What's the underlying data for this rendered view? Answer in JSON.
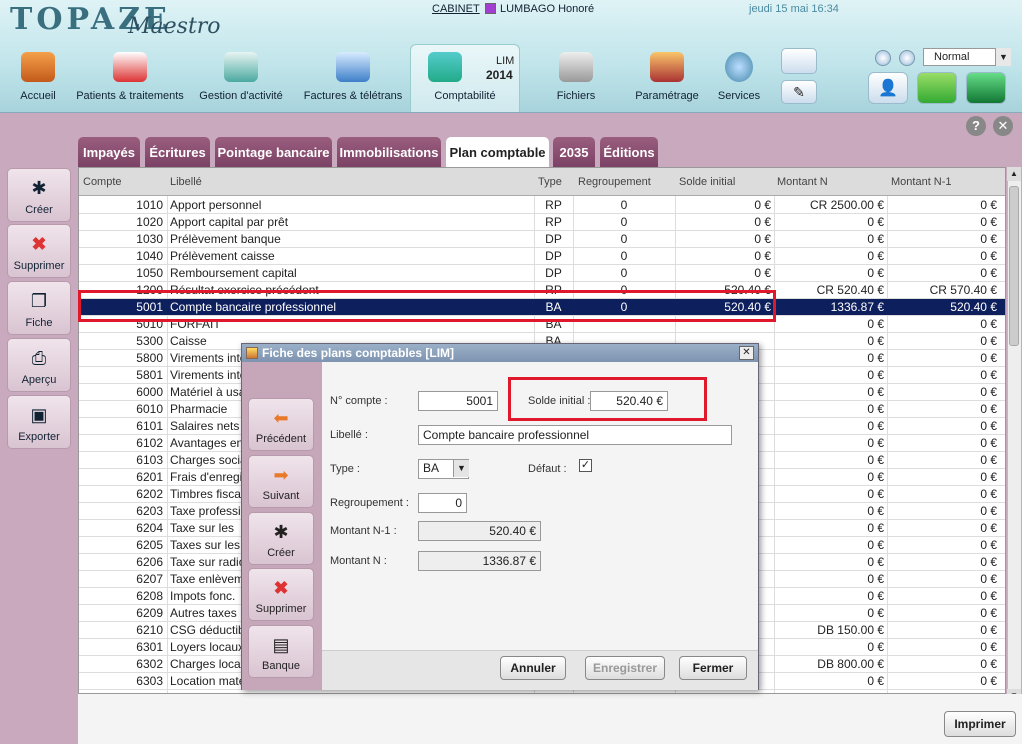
{
  "app": {
    "logo": "TOPAZE",
    "logo_sub": "Maestro"
  },
  "topbar": {
    "cabinet": "CABINET",
    "user": "LUMBAGO Honoré",
    "user_color": "#a23fd0",
    "datetime": "jeudi 15 mai 16:34"
  },
  "modules": [
    {
      "label": "Accueil",
      "icon": "house-icon"
    },
    {
      "label": "Patients & traitements",
      "icon": "patients-icon"
    },
    {
      "label": "Gestion d'activité",
      "icon": "folder-icon"
    },
    {
      "label": "Factures & télétrans",
      "icon": "computer-icon"
    },
    {
      "label": "Comptabilité",
      "icon": "calculator-icon",
      "badge_top": "LIM",
      "badge_year": "2014"
    },
    {
      "label": "Fichiers",
      "icon": "database-icon"
    },
    {
      "label": "Paramétrage",
      "icon": "gears-icon"
    },
    {
      "label": "Services",
      "icon": "globe-icon"
    }
  ],
  "view_mode": "Normal",
  "tabs": [
    "Impayés",
    "Écritures",
    "Pointage bancaire",
    "Immobilisations",
    "Plan comptable",
    "2035",
    "Éditions"
  ],
  "active_tab": "Plan comptable",
  "side_actions": [
    "Créer",
    "Supprimer",
    "Fiche",
    "Aperçu",
    "Exporter"
  ],
  "table": {
    "columns": [
      "Compte",
      "Libellé",
      "Type",
      "Regroupement",
      "Solde initial",
      "Montant N",
      "Montant N-1"
    ],
    "rows": [
      [
        "1010",
        "Apport personnel",
        "RP",
        "0",
        "0 €",
        "CR 2500.00 €",
        "0 €"
      ],
      [
        "1020",
        "Apport capital par prêt",
        "RP",
        "0",
        "0 €",
        "0 €",
        "0 €"
      ],
      [
        "1030",
        "Prélèvement banque",
        "DP",
        "0",
        "0 €",
        "0 €",
        "0 €"
      ],
      [
        "1040",
        "Prélèvement caisse",
        "DP",
        "0",
        "0 €",
        "0 €",
        "0 €"
      ],
      [
        "1050",
        "Remboursement capital",
        "DP",
        "0",
        "0 €",
        "0 €",
        "0 €"
      ],
      [
        "1200",
        "Résultat exercice précédent",
        "RP",
        "0",
        "520.40 €",
        "CR 520.40 €",
        "CR 570.40 €"
      ],
      [
        "5001",
        "Compte bancaire professionnel",
        "BA",
        "0",
        "520.40 €",
        "1336.87 €",
        "520.40 €"
      ],
      [
        "5010",
        "FORFAIT",
        "BA",
        "",
        "",
        "0 €",
        "0 €"
      ],
      [
        "5300",
        "Caisse",
        "BA",
        "",
        "",
        "0 €",
        "0 €"
      ],
      [
        "5800",
        "Virements internes",
        "",
        "",
        "",
        "0 €",
        "0 €"
      ],
      [
        "5801",
        "Virements internes",
        "",
        "",
        "",
        "0 €",
        "0 €"
      ],
      [
        "6000",
        "Matériel à usage",
        "",
        "",
        "",
        "0 €",
        "0 €"
      ],
      [
        "6010",
        "Pharmacie",
        "",
        "",
        "",
        "0 €",
        "0 €"
      ],
      [
        "6101",
        "Salaires nets",
        "",
        "",
        "",
        "0 €",
        "0 €"
      ],
      [
        "6102",
        "Avantages en",
        "",
        "",
        "",
        "0 €",
        "0 €"
      ],
      [
        "6103",
        "Charges sociales",
        "",
        "",
        "",
        "0 €",
        "0 €"
      ],
      [
        "6201",
        "Frais d'enregistrement",
        "",
        "",
        "",
        "0 €",
        "0 €"
      ],
      [
        "6202",
        "Timbres fiscaux",
        "",
        "",
        "",
        "0 €",
        "0 €"
      ],
      [
        "6203",
        "Taxe professionnelle",
        "",
        "",
        "",
        "0 €",
        "0 €"
      ],
      [
        "6204",
        "Taxe sur les",
        "",
        "",
        "",
        "0 €",
        "0 €"
      ],
      [
        "6205",
        "Taxes sur les",
        "",
        "",
        "",
        "0 €",
        "0 €"
      ],
      [
        "6206",
        "Taxe sur radio",
        "",
        "",
        "",
        "0 €",
        "0 €"
      ],
      [
        "6207",
        "Taxe enlèvement",
        "",
        "",
        "",
        "0 €",
        "0 €"
      ],
      [
        "6208",
        "Impots fonc.",
        "",
        "",
        "",
        "0 €",
        "0 €"
      ],
      [
        "6209",
        "Autres taxes",
        "",
        "",
        "",
        "0 €",
        "0 €"
      ],
      [
        "6210",
        "CSG déductible",
        "",
        "",
        "",
        "DB 150.00 €",
        "0 €"
      ],
      [
        "6301",
        "Loyers locaux",
        "",
        "",
        "",
        "0 €",
        "0 €"
      ],
      [
        "6302",
        "Charges locatives",
        "",
        "",
        "",
        "DB 800.00 €",
        "0 €"
      ],
      [
        "6303",
        "Location matériel",
        "",
        "",
        "",
        "0 €",
        "0 €"
      ]
    ],
    "selected_index": 6
  },
  "print_label": "Imprimer",
  "dialog": {
    "title": "Fiche des plans comptables [LIM]",
    "side_actions": [
      "Précédent",
      "Suivant",
      "Créer",
      "Supprimer",
      "Banque"
    ],
    "labels": {
      "compte": "N° compte :",
      "solde": "Solde initial :",
      "libelle": "Libellé :",
      "type": "Type :",
      "defaut": "Défaut :",
      "regroupement": "Regroupement :",
      "montant_n1": "Montant N-1 :",
      "montant_n": "Montant N :"
    },
    "values": {
      "compte": "5001",
      "solde": "520.40 €",
      "libelle": "Compte bancaire professionnel",
      "type": "BA",
      "defaut_check": "✓",
      "regroupement": "0",
      "montant_n1": "520.40 €",
      "montant_n": "1336.87 €"
    },
    "buttons": {
      "annuler": "Annuler",
      "enregistrer": "Enregistrer",
      "fermer": "Fermer"
    }
  },
  "colors": {
    "accent": "#0d1f5c",
    "highlight": "#e0182b",
    "tab": "#7c4265"
  }
}
